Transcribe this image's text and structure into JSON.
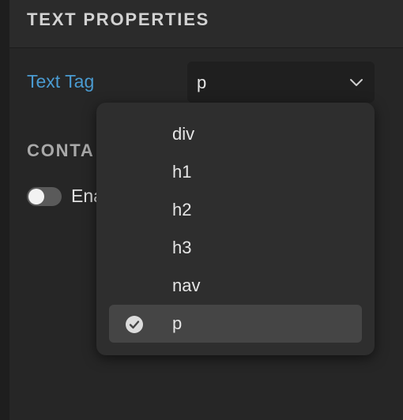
{
  "section": {
    "title": "TEXT PROPERTIES"
  },
  "text_tag": {
    "label": "Text Tag",
    "value": "p",
    "chevron_icon": "chevron-down-icon"
  },
  "container": {
    "title": "CONTA"
  },
  "toggle": {
    "label": "Ena",
    "state": "off"
  },
  "dropdown": {
    "options": [
      {
        "label": "div",
        "selected": false
      },
      {
        "label": "h1",
        "selected": false
      },
      {
        "label": "h2",
        "selected": false
      },
      {
        "label": "h3",
        "selected": false
      },
      {
        "label": "nav",
        "selected": false
      },
      {
        "label": "p",
        "selected": true
      }
    ],
    "selected_icon": "check-circle-icon"
  },
  "colors": {
    "accent_label": "#4a9bd1",
    "panel_bg": "#262626",
    "dropdown_bg": "#2e2e2e",
    "selected_row_bg": "#454545"
  }
}
